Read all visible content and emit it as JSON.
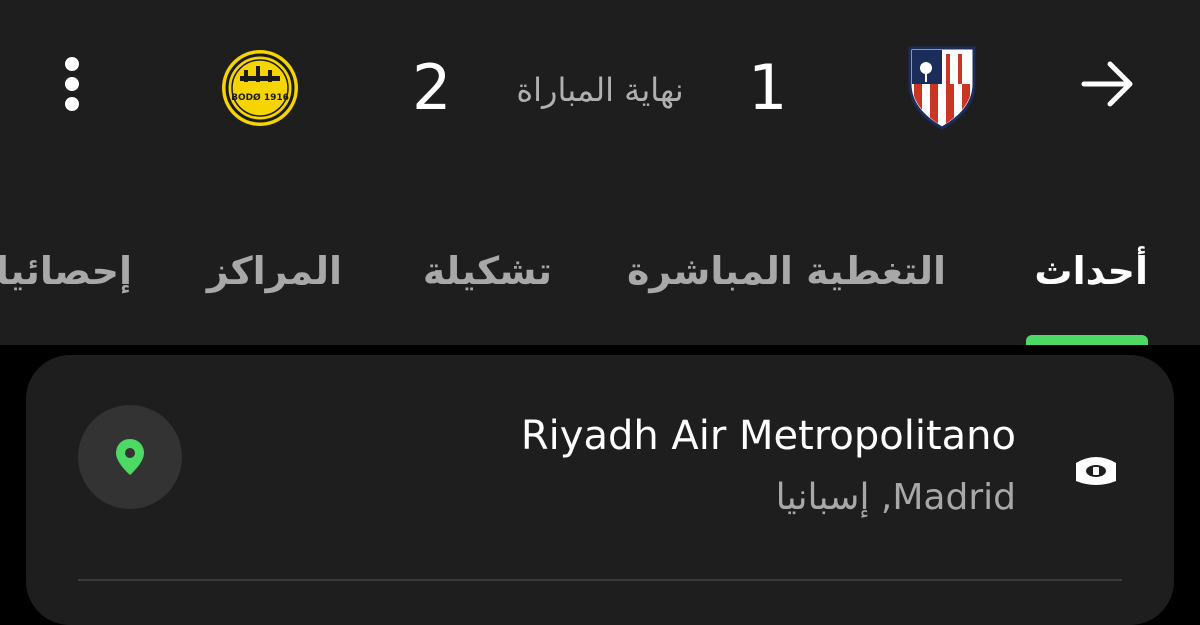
{
  "match": {
    "home_score": "2",
    "away_score": "1",
    "status": "نهاية المباراة",
    "home_logo_text": "BODØ 1916",
    "home_logo_color": "#f5d400",
    "away_logo_color": "#cb3524"
  },
  "tabs": [
    {
      "label": "أحداث",
      "active": true
    },
    {
      "label": "التغطية المباشرة",
      "active": false
    },
    {
      "label": "تشكيلة",
      "active": false
    },
    {
      "label": "المراكز",
      "active": false
    },
    {
      "label": "إحصائيات",
      "active": false
    }
  ],
  "venue": {
    "name": "Riyadh Air Metropolitano",
    "city": "إسبانيا ,Madrid"
  },
  "icons": {
    "menu": "more-vertical-icon",
    "back": "arrow-right-icon",
    "location": "location-pin-icon",
    "stadium": "stadium-icon"
  },
  "colors": {
    "accent": "#4cd964",
    "background": "#1e1e1e"
  }
}
